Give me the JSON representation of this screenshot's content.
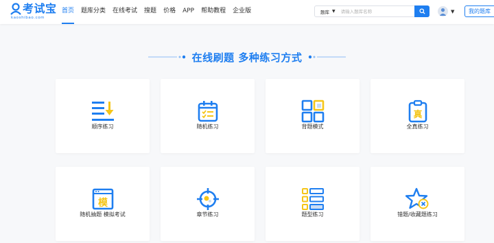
{
  "header": {
    "logo_text": "考试宝",
    "logo_sub": "kaoshibao.com",
    "nav": [
      "首页",
      "题库分类",
      "在线考试",
      "搜题",
      "价格",
      "APP",
      "帮助教程",
      "企业版"
    ],
    "active_index": 0,
    "search": {
      "scope": "题库",
      "placeholder": "请输入题库名称"
    },
    "my_bank_label": "我的题库"
  },
  "section": {
    "title": "在线刷题 多种练习方式"
  },
  "cards": [
    {
      "label": "顺序练习",
      "icon": "sequential-list-icon"
    },
    {
      "label": "随机练习",
      "icon": "calendar-random-icon"
    },
    {
      "label": "背题模式",
      "icon": "grid-memorize-icon"
    },
    {
      "label": "全真练习",
      "icon": "clipboard-real-icon"
    },
    {
      "label": "随机抽题 模拟考试",
      "icon": "mock-exam-window-icon"
    },
    {
      "label": "章节练习",
      "icon": "target-chapter-icon"
    },
    {
      "label": "题型练习",
      "icon": "question-type-list-icon"
    },
    {
      "label": "错题/收藏题练习",
      "icon": "star-mistake-icon"
    }
  ],
  "colors": {
    "brand": "#1e7ef0",
    "accent": "#f5c518",
    "background": "#f7f8fa"
  }
}
